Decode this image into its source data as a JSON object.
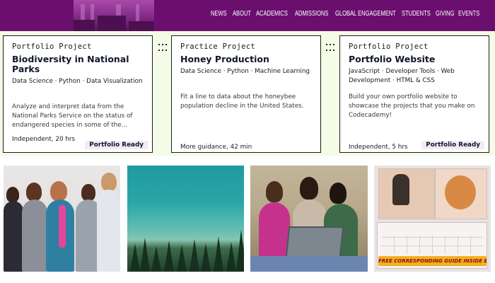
{
  "nav": {
    "items": [
      "NEWS",
      "ABOUT",
      "ACADEMICS",
      "ADMISSIONS",
      "GLOBAL ENGAGEMENT",
      "STUDENTS",
      "GIVING",
      "EVENTS"
    ],
    "background": "#6b0f6f"
  },
  "cards": [
    {
      "type": "Portfolio Project",
      "title": "Biodiversity in National Parks",
      "tags": "Data Science · Python · Data Visualization",
      "description": "Analyze and interpret data from the National Parks Service on the status of endangered species in some of the…",
      "meta": "Independent, 20 hrs",
      "badge": "Portfolio Ready"
    },
    {
      "type": "Practice Project",
      "title": "Honey Production",
      "tags": "Data Science · Python · Machine Learning",
      "description": "Fit a line to data about the honeybee population decline in the United States.",
      "meta": "More guidance, 42 min",
      "badge": ""
    },
    {
      "type": "Portfolio Project",
      "title": "Portfolio Website",
      "tags": "JavaScript · Developer Tools · Web Development · HTML & CSS",
      "description": "Build your own portfolio website to showcase the projects that you make on Codecademy!",
      "meta": "Independent, 5 hrs",
      "badge": "Portfolio Ready"
    }
  ],
  "photos": {
    "calendar_ribbon": "FREE CORRESPONDING GUIDE INSIDE EACH CALENDAR!"
  },
  "colors": {
    "strip_background": "#f4fbe6",
    "badge_background": "#f5eaf3",
    "title_color": "#10162f"
  }
}
